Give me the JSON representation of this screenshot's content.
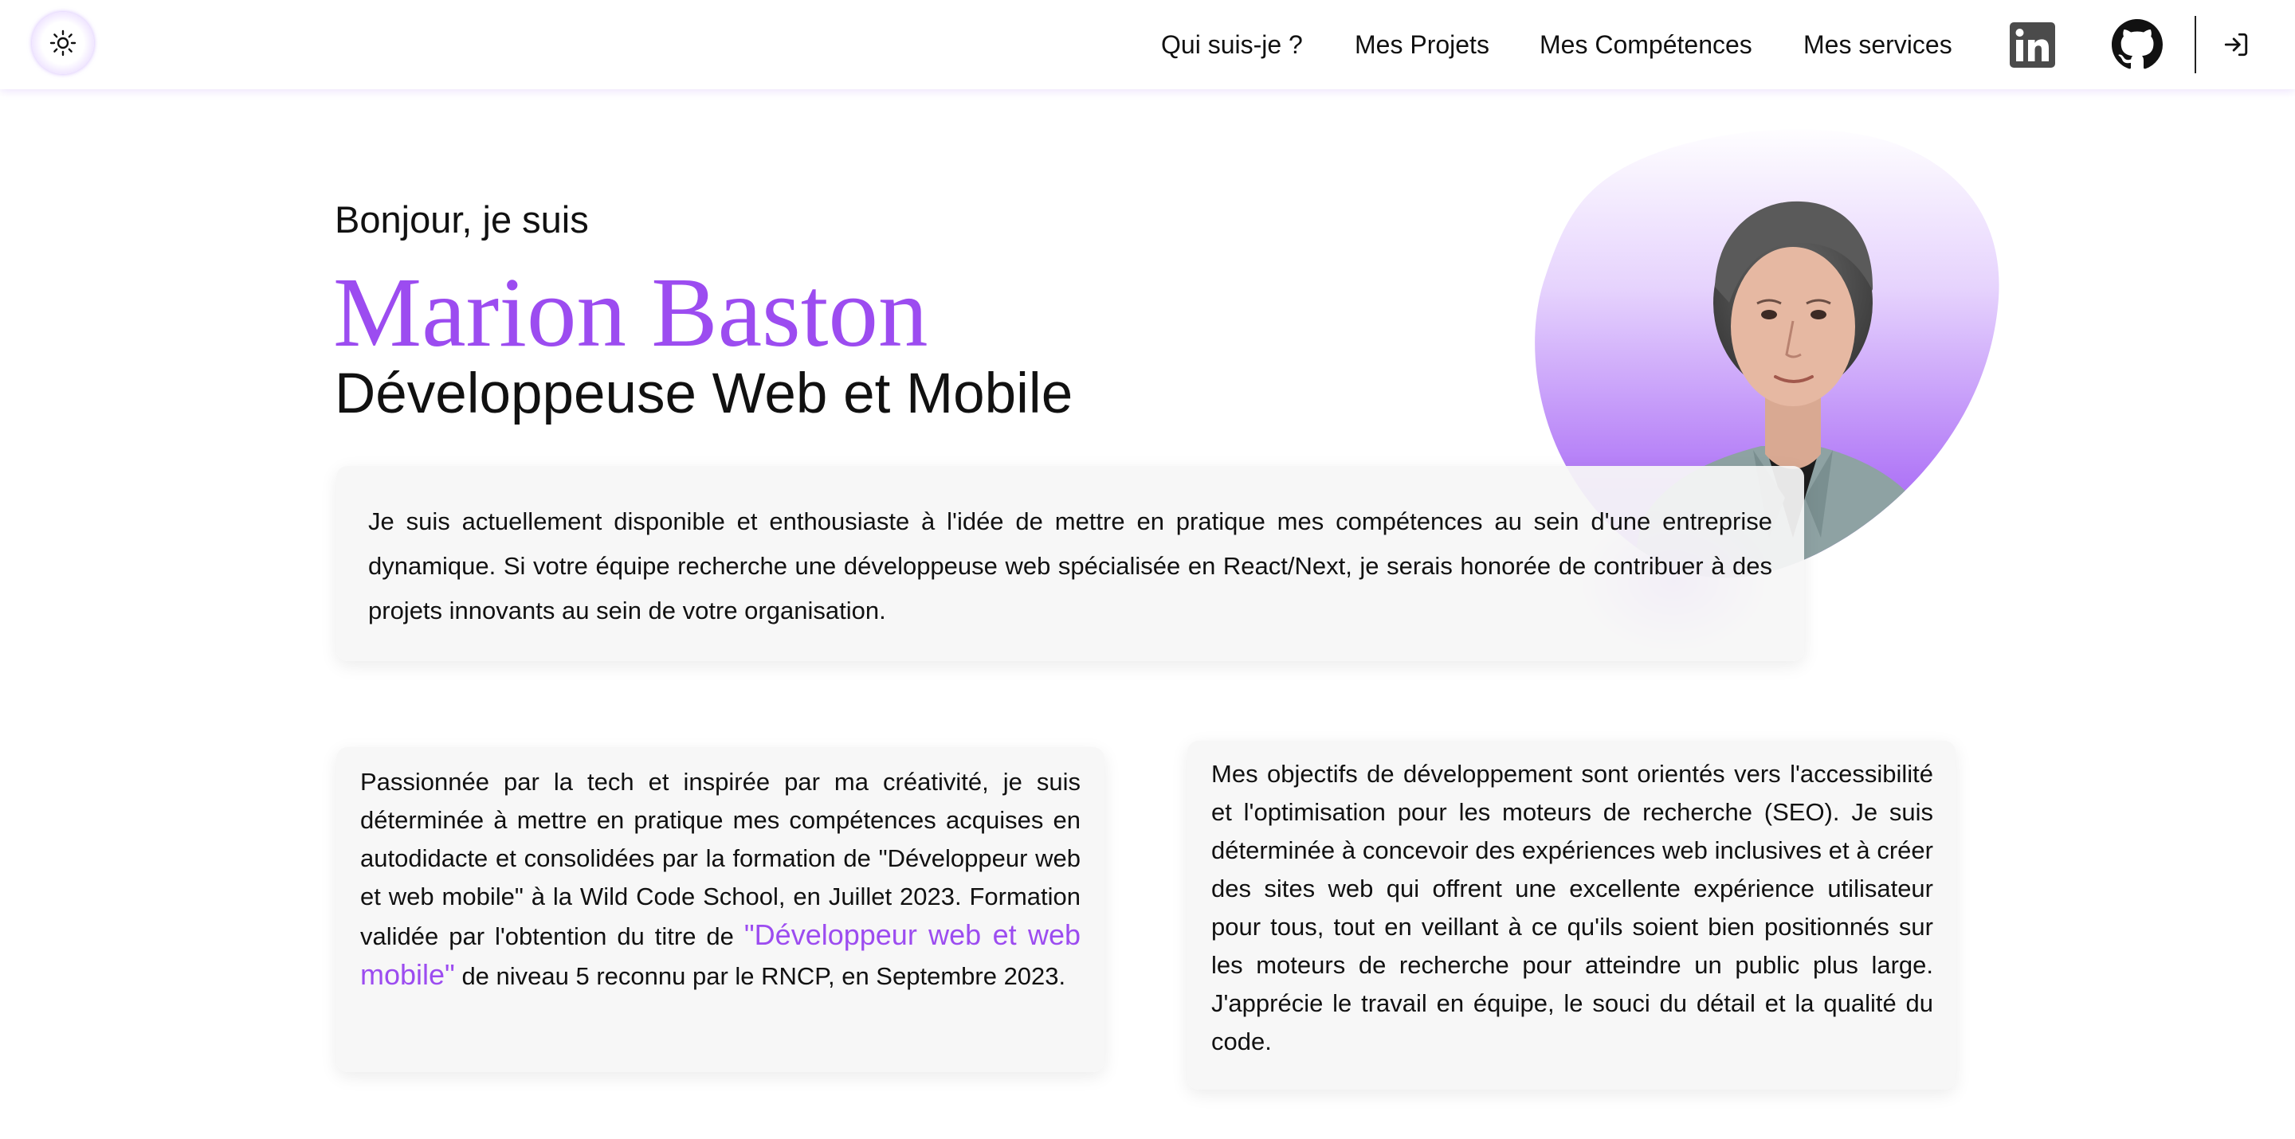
{
  "header": {
    "theme_toggle_icon": "sun-icon",
    "nav": [
      {
        "label": "Qui suis-je ?"
      },
      {
        "label": "Mes Projets"
      },
      {
        "label": "Mes Compétences"
      },
      {
        "label": "Mes services"
      }
    ],
    "social": [
      {
        "icon": "linkedin-icon"
      },
      {
        "icon": "github-icon"
      }
    ],
    "login_icon": "login-icon"
  },
  "hero": {
    "greeting": "Bonjour, je suis",
    "name": "Marion Baston",
    "role": "Développeuse Web et Mobile",
    "accent_color": "#9c4cf0"
  },
  "intro": {
    "text": "Je suis actuellement disponible et enthousiaste à l'idée de mettre en pratique mes compétences au sein d'une entreprise dynamique. Si votre équipe recherche une développeuse web spécialisée en React/Next, je serais honorée de contribuer à des projets innovants au sein de votre organisation."
  },
  "about": {
    "left_before": "Passionnée par la tech et inspirée par ma créativité, je suis déterminée à mettre en pratique mes compétences acquises en autodidacte et consolidées par la formation de \"Développeur web et web mobile\" à la Wild Code School, en Juillet 2023. Formation validée par l'obtention du titre de ",
    "left_highlight": "\"Développeur web et web mobile\"",
    "left_after": " de niveau 5 reconnu par le RNCP, en Septembre 2023.",
    "right": "Mes objectifs de développement sont orientés vers l'accessibilité et l'optimisation pour les moteurs de recherche (SEO). Je suis déterminée à concevoir des expériences web inclusives et à créer des sites web qui offrent une excellente expérience utilisateur pour tous, tout en veillant à ce qu'ils soient bien positionnés sur les moteurs de recherche pour atteindre un public plus large. J'apprécie le travail en équipe, le souci du détail et la qualité du code."
  }
}
